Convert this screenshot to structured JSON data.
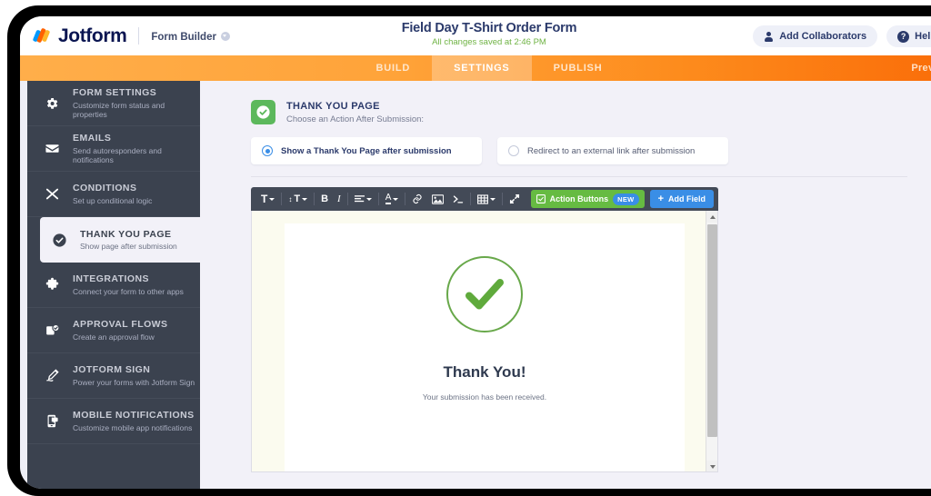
{
  "header": {
    "logo_text": "Jotform",
    "logo_icon": "jotform-logo-icon",
    "builder_label": "Form Builder",
    "form_title": "Field Day T-Shirt Order Form",
    "save_status": "All changes saved at 2:46 PM",
    "save_status_color": "#6fb344",
    "collaborators_label": "Add Collaborators",
    "collaborators_icon": "person-icon",
    "help_label": "Help",
    "help_icon": "question-mark-icon"
  },
  "nav": {
    "tabs": [
      {
        "label": "BUILD",
        "active": false
      },
      {
        "label": "SETTINGS",
        "active": true
      },
      {
        "label": "PUBLISH",
        "active": false
      }
    ],
    "preview_label": "Preview",
    "accent_color": "#fa6c08"
  },
  "sidebar": {
    "items": [
      {
        "title": "FORM SETTINGS",
        "sub": "Customize form status and properties",
        "icon": "gear-icon",
        "active": false
      },
      {
        "title": "EMAILS",
        "sub": "Send autoresponders and notifications",
        "icon": "envelope-icon",
        "active": false
      },
      {
        "title": "CONDITIONS",
        "sub": "Set up conditional logic",
        "icon": "shuffle-icon",
        "active": false
      },
      {
        "title": "THANK YOU PAGE",
        "sub": "Show page after submission",
        "icon": "check-circle-icon",
        "active": true
      },
      {
        "title": "INTEGRATIONS",
        "sub": "Connect your form to other apps",
        "icon": "puzzle-icon",
        "active": false
      },
      {
        "title": "APPROVAL FLOWS",
        "sub": "Create an approval flow",
        "icon": "approval-icon",
        "active": false
      },
      {
        "title": "JOTFORM SIGN",
        "sub": "Power your forms with Jotform Sign",
        "icon": "pen-icon",
        "active": false
      },
      {
        "title": "MOBILE NOTIFICATIONS",
        "sub": "Customize mobile app notifications",
        "icon": "mobile-icon",
        "active": false
      }
    ]
  },
  "main": {
    "panel_title": "THANK YOU PAGE",
    "panel_subtitle": "Choose an Action After Submission:",
    "panel_icon": "check-badge-icon",
    "panel_icon_color": "#5cb85c",
    "options": [
      {
        "label": "Show a Thank You Page after submission",
        "selected": true
      },
      {
        "label": "Redirect to an external link after submission",
        "selected": false
      }
    ],
    "toolbar": {
      "buttons": [
        {
          "name": "font-family",
          "glyph": "T",
          "has_caret": true
        },
        {
          "name": "font-size",
          "glyph": "↨T",
          "has_caret": true
        },
        {
          "name": "bold",
          "glyph": "B",
          "has_caret": false
        },
        {
          "name": "italic",
          "glyph": "I",
          "has_caret": false
        },
        {
          "name": "align",
          "glyph": "≡",
          "has_caret": true
        },
        {
          "name": "text-color",
          "glyph": "A",
          "has_caret": true
        },
        {
          "name": "link",
          "glyph": "ὑ7",
          "has_caret": false
        },
        {
          "name": "image",
          "glyph": "▣",
          "has_caret": false
        },
        {
          "name": "code",
          "glyph": "≻_",
          "has_caret": false
        },
        {
          "name": "table",
          "glyph": "▦",
          "has_caret": true
        },
        {
          "name": "fullscreen",
          "glyph": "⤡",
          "has_caret": false
        }
      ],
      "action_buttons_label": "Action Buttons",
      "action_buttons_badge": "NEW",
      "action_buttons_color": "#66bb42",
      "add_field_label": "Add Field",
      "add_field_color": "#3a8ee6"
    },
    "preview": {
      "heading": "Thank You!",
      "body": "Your submission has been received.",
      "check_icon": "green-check-circle-icon",
      "check_color": "#68a84a"
    }
  }
}
